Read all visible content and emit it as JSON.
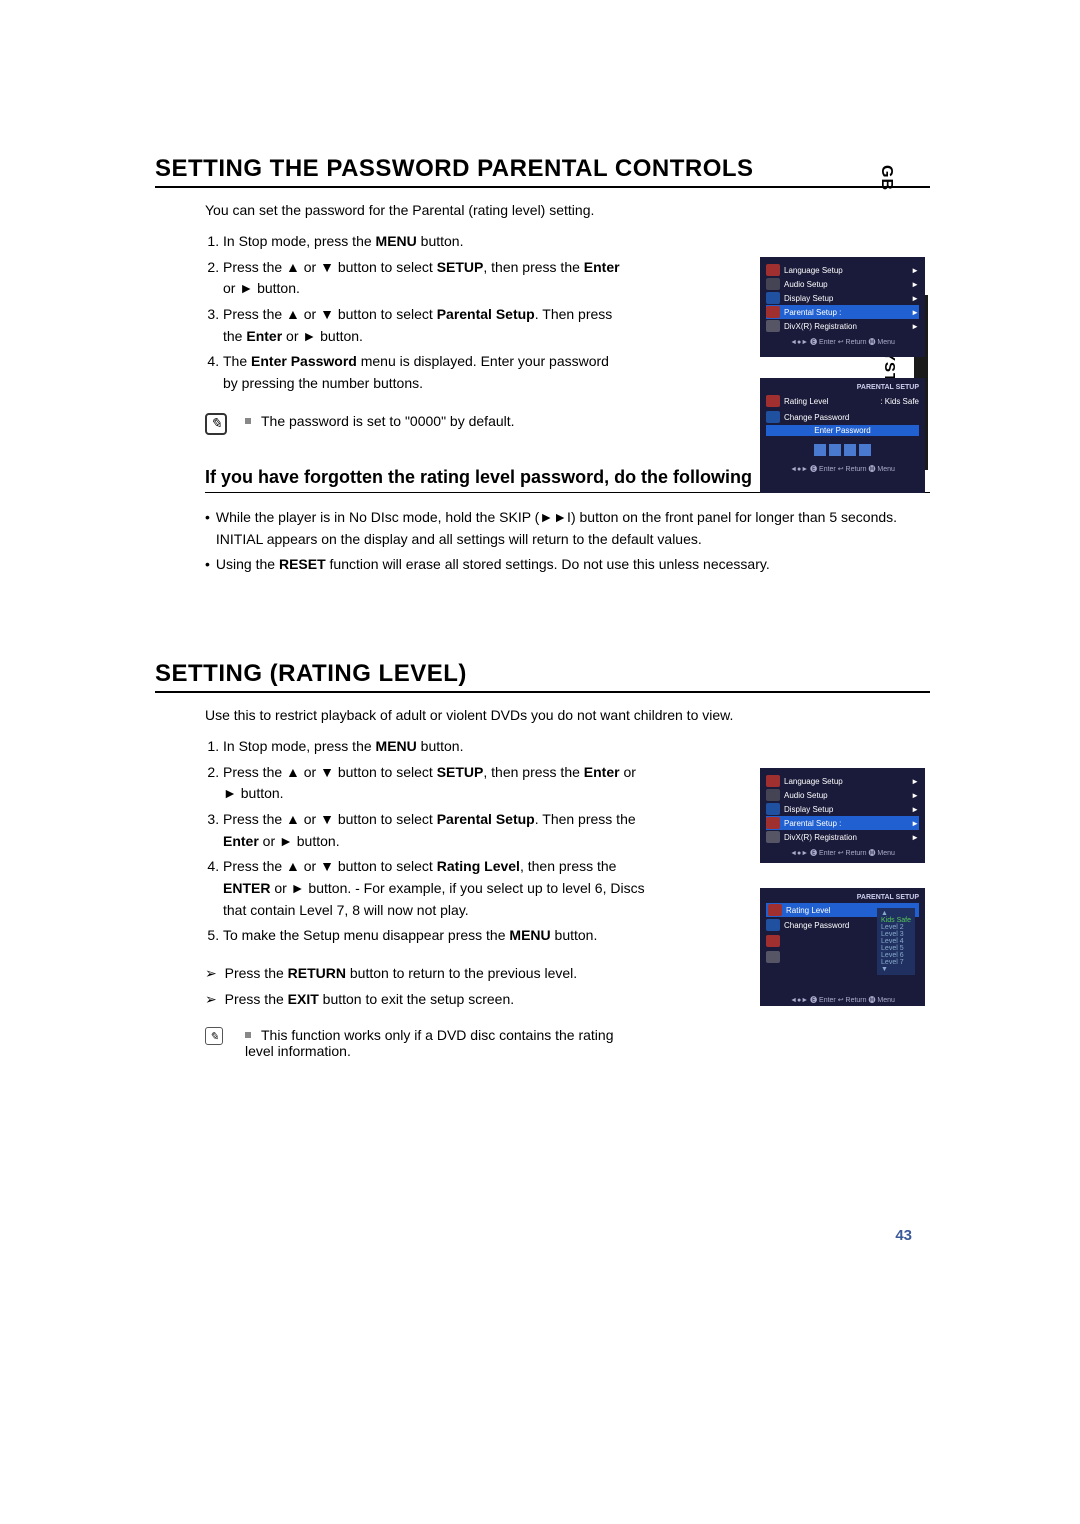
{
  "sideTab": {
    "gb": "GB",
    "system": "SYSTEM SETUP"
  },
  "section1": {
    "title": "SETTING THE PASSWORD PARENTAL CONTROLS",
    "intro": "You can set the password for the Parental (rating level) setting.",
    "steps": {
      "s1_a": "In Stop mode, press the ",
      "s1_b": "MENU",
      "s1_c": " button.",
      "s2_a": "Press the ▲ or ▼ button to select ",
      "s2_b": "SETUP",
      "s2_c": ", then press the ",
      "s2_d": "Enter",
      "s2_e": " or ► button.",
      "s3_a": "Press the ▲ or ▼ button to select ",
      "s3_b": "Parental Setup",
      "s3_c": ". Then press the ",
      "s3_d": "Enter",
      "s3_e": " or ► button.",
      "s4_a": "The ",
      "s4_b": "Enter Password",
      "s4_c": " menu is displayed. Enter your password by pressing the number buttons."
    },
    "note": "The password is set to \"0000\" by default."
  },
  "subsection": {
    "title": "If you have forgotten the rating level password, do the following",
    "b1": "While the player is in No DIsc mode, hold the SKIP (►►I) button on the front panel for longer than 5 seconds. INITIAL appears on the display and all settings will return to the default values.",
    "b2_a": "Using the ",
    "b2_b": "RESET",
    "b2_c": " function will erase all stored settings. Do not use this unless necessary."
  },
  "section2": {
    "title": "SETTING (RATING LEVEL)",
    "intro": "Use this to restrict playback of adult or violent DVDs you do not want children to view.",
    "steps": {
      "s1_a": "In Stop mode, press the ",
      "s1_b": "MENU",
      "s1_c": " button.",
      "s2_a": "Press the ▲ or ▼ button to select ",
      "s2_b": "SETUP",
      "s2_c": ", then press the ",
      "s2_d": "Enter",
      "s2_e": " or ► button.",
      "s3_a": "Press the ▲ or ▼ button to select ",
      "s3_b": "Parental Setup",
      "s3_c": ". Then press the ",
      "s3_d": "Enter",
      "s3_e": " or ► button.",
      "s4_a": "Press the ▲ or ▼ button to select ",
      "s4_b": "Rating Level",
      "s4_c": ", then press the ",
      "s4_d": "ENTER",
      "s4_e": " or ► button. - For example, if you select up to level 6, Discs that contain Level 7, 8 will now not play.",
      "s5_a": "To make the Setup menu disappear press the ",
      "s5_b": "MENU",
      "s5_c": " button."
    },
    "arrow1_a": "Press the ",
    "arrow1_b": "RETURN",
    "arrow1_c": " button to return to the previous level.",
    "arrow2_a": "Press the ",
    "arrow2_b": "EXIT",
    "arrow2_c": " button to exit the setup screen.",
    "note": "This function works only if a DVD disc contains the rating level information."
  },
  "osd": {
    "setup": {
      "lang": "Language Setup",
      "audio": "Audio Setup",
      "display": "Display Setup",
      "parental": "Parental Setup :",
      "divx": "DivX(R) Registration"
    },
    "parental": {
      "title": "PARENTAL SETUP",
      "rating": "Rating Level",
      "ratingVal": ": Kids Safe",
      "change": "Change Password",
      "enterpw": "Enter Password"
    },
    "levels": {
      "up": "▲",
      "kids": "Kids Safe",
      "l2": "Level 2",
      "l3": "Level 3",
      "l4": "Level 4",
      "l5": "Level 5",
      "l6": "Level 6",
      "l7": "Level 7",
      "down": "▼"
    },
    "footer": "◄●►   🅔 Enter   ↩ Return   🅜 Menu"
  },
  "pageNumber": "43"
}
